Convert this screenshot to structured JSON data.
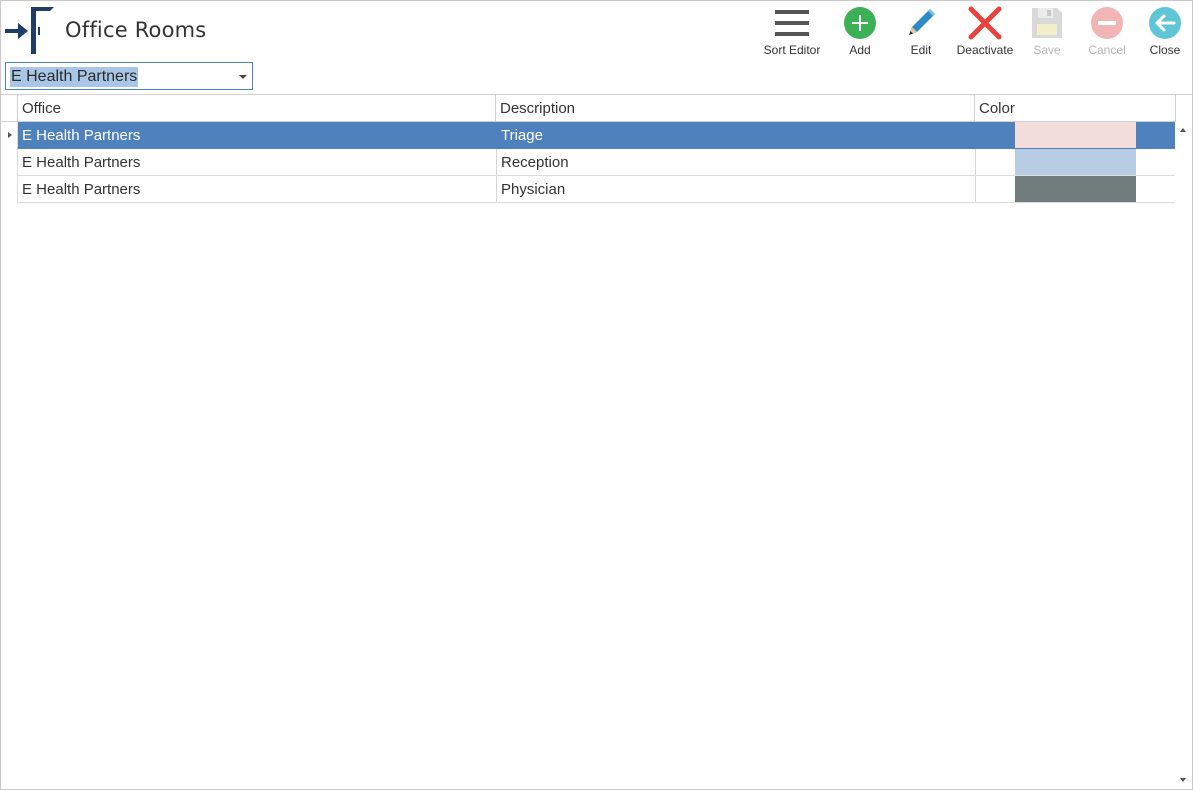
{
  "header": {
    "title": "Office Rooms"
  },
  "toolbar": {
    "sort_editor": "Sort Editor",
    "add": "Add",
    "edit": "Edit",
    "deactivate": "Deactivate",
    "save": "Save",
    "cancel": "Cancel",
    "close": "Close"
  },
  "icons": {
    "sort_editor": "hamburger-menu-icon",
    "add": "plus-circle-icon",
    "edit": "pencil-icon",
    "deactivate": "red-x-icon",
    "save": "floppy-disk-icon",
    "cancel": "minus-circle-icon",
    "close": "back-arrow-circle-icon"
  },
  "office_select": {
    "value": "E Health Partners"
  },
  "grid": {
    "columns": [
      "Office",
      "Description",
      "Color"
    ],
    "rows": [
      {
        "office": "E Health Partners",
        "description": "Triage",
        "color": "#f2dcdc",
        "selected": true
      },
      {
        "office": "E Health Partners",
        "description": "Reception",
        "color": "#b8cce4",
        "selected": false
      },
      {
        "office": "E Health Partners",
        "description": "Physician",
        "color": "#717d7d",
        "selected": false
      }
    ]
  },
  "colors": {
    "accent_blue": "#4f81bd",
    "add_green": "#3cb054",
    "deactivate_red": "#e8423c",
    "close_teal": "#5ec6d6",
    "edit_blue": "#2f8ac8"
  }
}
